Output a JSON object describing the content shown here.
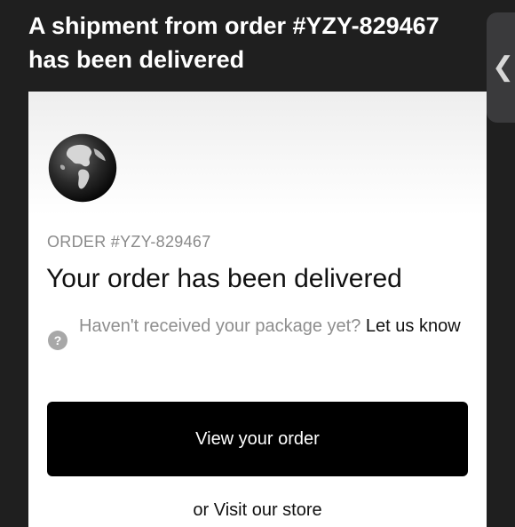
{
  "email": {
    "subject": "A shipment from order #YZY-829467 has been delivered"
  },
  "nav": {
    "back_icon": "chevron-left-icon"
  },
  "card": {
    "logo": "globe-logo",
    "order_label": "ORDER #YZY-829467",
    "headline": "Your order has been delivered",
    "help": {
      "icon": "question-circle-icon",
      "text": "Haven't received your package yet?",
      "link": "Let us know"
    },
    "view_button": "View your order",
    "store_prefix": "or",
    "store_link": "Visit our store"
  }
}
